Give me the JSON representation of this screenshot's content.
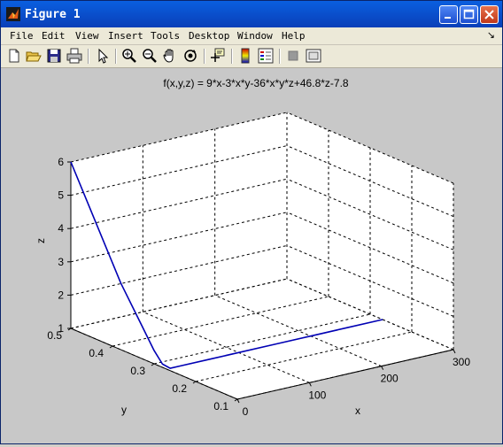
{
  "window": {
    "title": "Figure 1"
  },
  "menu": {
    "items": [
      "File",
      "Edit",
      "View",
      "Insert",
      "Tools",
      "Desktop",
      "Window",
      "Help"
    ],
    "overflow_arrow": "↘"
  },
  "toolbar": {
    "tools": [
      "new-file-icon",
      "open-folder-icon",
      "save-icon",
      "print-icon",
      "pointer-icon",
      "zoom-in-icon",
      "zoom-out-icon",
      "pan-hand-icon",
      "rotate-3d-icon",
      "data-cursor-icon",
      "colorbar-icon",
      "legend-icon",
      "hide-plot-tools-icon",
      "show-plot-tools-icon"
    ]
  },
  "colors": {
    "titlebar": "#0a4fd8",
    "axes_background": "#ffffff",
    "figure_background": "#c8c8c8",
    "line": "#0000b4"
  },
  "chart_data": {
    "type": "line",
    "title": "f(x,y,z) = 9*x-3*x*y-36*x*y*z+46.8*z-7.8",
    "xlabel": "x",
    "ylabel": "y",
    "zlabel": "z",
    "xlim": [
      0,
      300
    ],
    "ylim": [
      0.1,
      0.5
    ],
    "zlim": [
      1,
      6
    ],
    "xticks": [
      "0",
      "100",
      "200",
      "300"
    ],
    "yticks": [
      "0.1",
      "0.2",
      "0.3",
      "0.4",
      "0.5"
    ],
    "zticks": [
      "1",
      "2",
      "3",
      "4",
      "5",
      "6"
    ],
    "grid": true,
    "series": [
      {
        "points": [
          {
            "x": 0,
            "y": 0.5,
            "z": 6.0
          },
          {
            "x": 0,
            "y": 0.46,
            "z": 5.0
          },
          {
            "x": 0,
            "y": 0.42,
            "z": 4.0
          },
          {
            "x": 0,
            "y": 0.38,
            "z": 3.0
          },
          {
            "x": 0,
            "y": 0.33,
            "z": 2.0
          },
          {
            "x": 0,
            "y": 0.3,
            "z": 1.4
          },
          {
            "x": 0,
            "y": 0.28,
            "z": 1.1
          },
          {
            "x": 5,
            "y": 0.27,
            "z": 1.0
          },
          {
            "x": 20,
            "y": 0.27,
            "z": 1.0
          },
          {
            "x": 60,
            "y": 0.27,
            "z": 1.0
          },
          {
            "x": 100,
            "y": 0.27,
            "z": 1.0
          },
          {
            "x": 150,
            "y": 0.27,
            "z": 1.0
          },
          {
            "x": 200,
            "y": 0.27,
            "z": 1.0
          },
          {
            "x": 250,
            "y": 0.27,
            "z": 1.0
          },
          {
            "x": 300,
            "y": 0.27,
            "z": 1.0
          }
        ]
      }
    ]
  }
}
